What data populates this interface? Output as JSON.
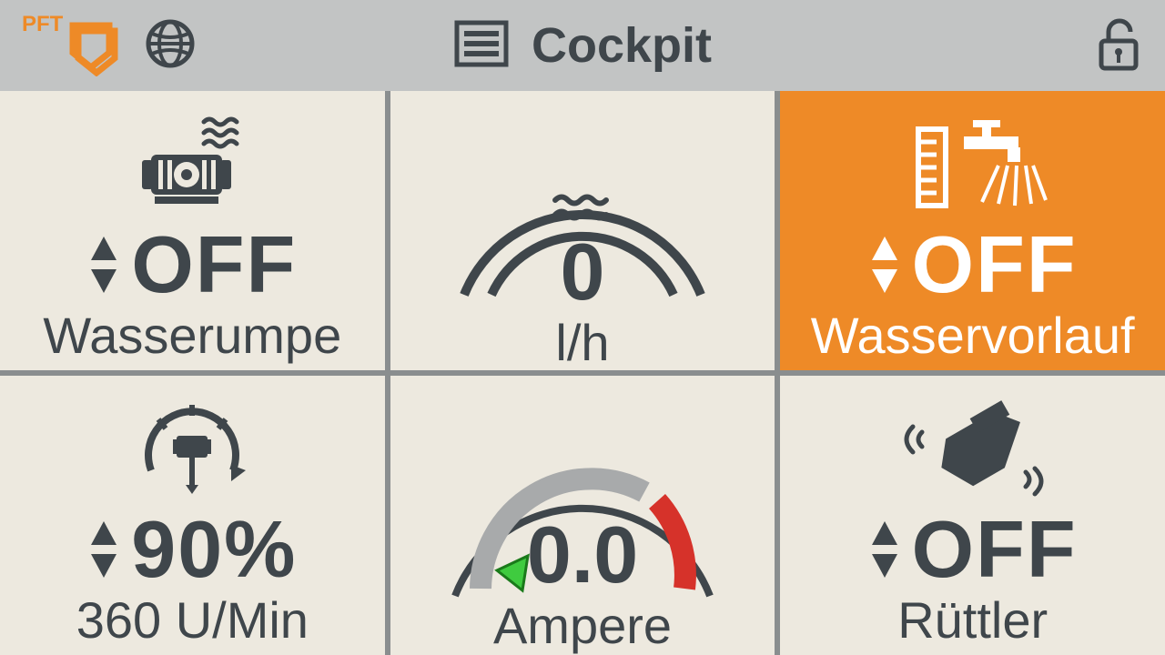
{
  "header": {
    "brand": "PFT",
    "title": "Cockpit"
  },
  "tiles": {
    "wasserumpe": {
      "value": "OFF",
      "label": "Wasserumpe"
    },
    "flow": {
      "value": "0",
      "unit": "l/h"
    },
    "wasservorlauf": {
      "value": "OFF",
      "label": "Wasservorlauf",
      "active": true
    },
    "speed": {
      "value": "90%",
      "label": "360 U/Min"
    },
    "ampere": {
      "value": "0.0",
      "label": "Ampere"
    },
    "ruettler": {
      "value": "OFF",
      "label": "Rüttler"
    }
  },
  "colors": {
    "accent": "#ee8a27",
    "dark": "#3f464b",
    "bg": "#ede9df",
    "header": "#c2c4c4"
  }
}
